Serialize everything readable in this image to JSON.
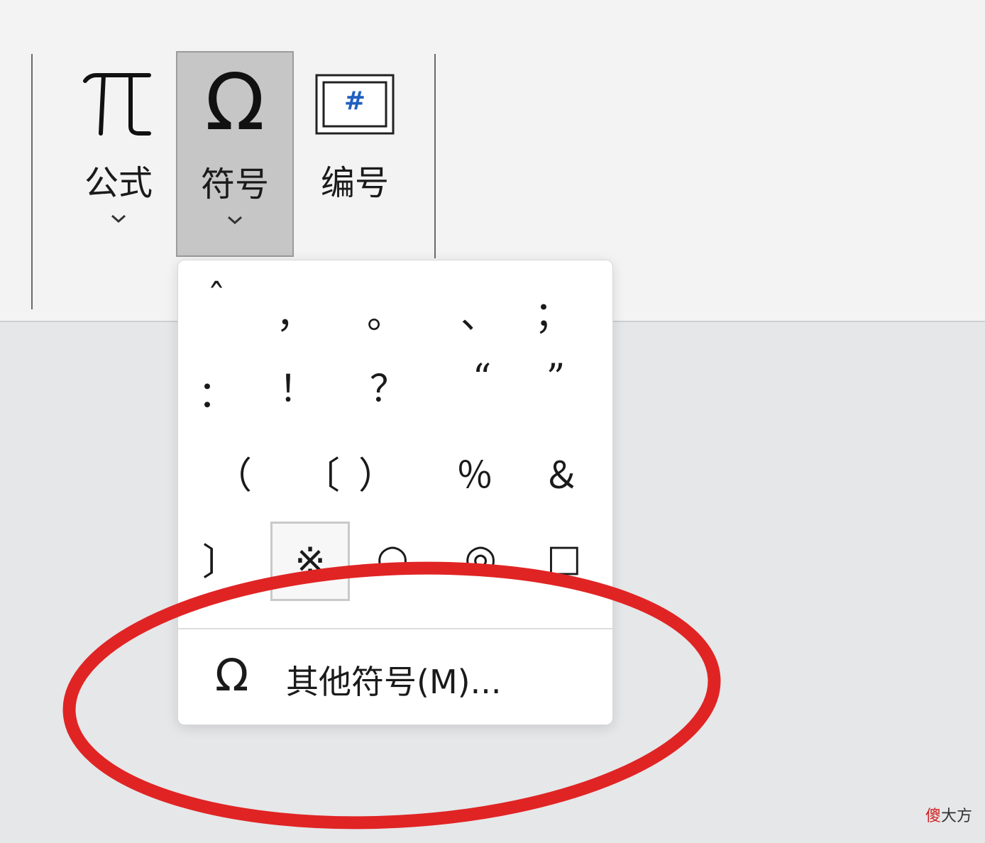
{
  "ribbon": {
    "buttons": [
      {
        "id": "formula",
        "glyph": "π",
        "label": "公式",
        "active": false
      },
      {
        "id": "symbol",
        "glyph": "Ω",
        "label": "符号",
        "active": true
      },
      {
        "id": "number",
        "glyph": "#",
        "label": "编号",
        "active": false
      }
    ]
  },
  "symbols": {
    "rows": [
      [
        "ˆ",
        "，",
        "。",
        "、",
        "；"
      ],
      [
        "：",
        "！",
        "？",
        "“",
        "”"
      ],
      [
        "（",
        "〔",
        "）",
        "％",
        "＆"
      ],
      [
        "〕",
        "※",
        "○",
        "◎",
        "□"
      ]
    ],
    "selected": "3.1"
  },
  "menu": {
    "more_symbols_icon": "Ω",
    "more_symbols_label": "其他符号(M)..."
  },
  "annotation": {
    "color": "#e02424"
  },
  "watermark": {
    "red": "傻",
    "rest": "大方"
  }
}
